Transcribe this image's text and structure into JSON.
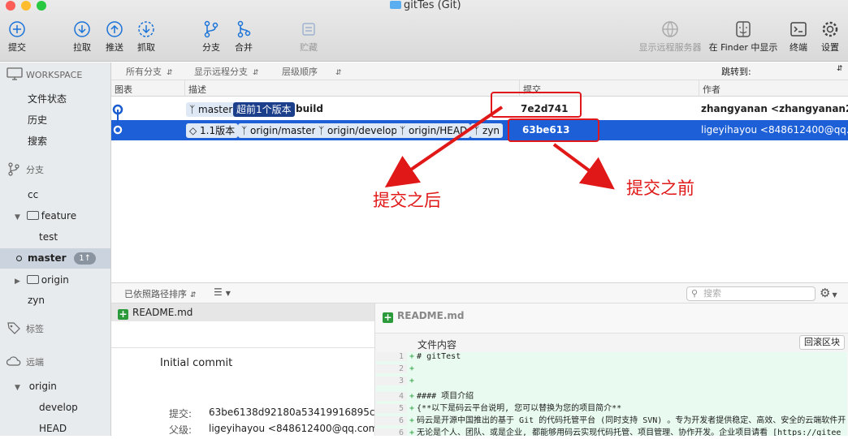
{
  "window": {
    "title": "gitTes (Git)"
  },
  "toolbar": {
    "commit": "提交",
    "pull": "拉取",
    "push": "推送",
    "fetch": "抓取",
    "branch": "分支",
    "merge": "合并",
    "stash": "贮藏",
    "remote_server": "显示远程服务器",
    "finder": "在 Finder 中显示",
    "terminal": "终端",
    "settings": "设置"
  },
  "sidebar": {
    "workspace": "WORKSPACE",
    "workspace_items": [
      "文件状态",
      "历史",
      "搜索"
    ],
    "branches_header": "分支",
    "branches": [
      "cc",
      "feature",
      "test",
      "master",
      "origin",
      "zyn"
    ],
    "master_badge": "1↑",
    "tags_header": "标签",
    "remotes_header": "远端",
    "remotes": [
      "origin",
      "develop",
      "HEAD"
    ]
  },
  "filter": {
    "all_branches": "所有分支",
    "show_remote": "显示远程分支",
    "order": "层级顺序",
    "jump": "跳转到:"
  },
  "columns": {
    "graph": "图表",
    "description": "描述",
    "commit": "提交",
    "author": "作者"
  },
  "commits": [
    {
      "tags": [
        "master",
        "超前1个版本"
      ],
      "message": "build",
      "hash": "7e2d741",
      "author": "zhangyanan <zhangyanan28@"
    },
    {
      "tags": [
        "1.1版本",
        "origin/master",
        "origin/develop",
        "origin/HEAD",
        "zyn"
      ],
      "message": "",
      "hash": "63be613",
      "author": "ligeyihayou <848612400@qq.co"
    }
  ],
  "annotations": {
    "after": "提交之后",
    "before": "提交之前"
  },
  "bottom": {
    "sort": "已依照路径排序",
    "search_placeholder": "搜索"
  },
  "file": {
    "name": "README.md",
    "content_label": "文件内容",
    "rollback": "回滚区块"
  },
  "commit_detail": {
    "message": "Initial commit",
    "commit_label": "提交:",
    "commit_value": "63be6138d92180a53419916895cd9",
    "parent_label": "父级:",
    "parent_value": "ligeyihayou <848612400@qq.com>"
  },
  "diff_lines": [
    {
      "n": "1",
      "text": "# gitTest"
    },
    {
      "n": "2",
      "text": ""
    },
    {
      "n": "3",
      "text": ""
    },
    {
      "n": "4",
      "text": "#### 项目介绍"
    },
    {
      "n": "5",
      "text": "{**以下是码云平台说明, 您可以替换为您的项目简介**"
    },
    {
      "n": "6",
      "text": "码云是开源中国推出的基于 Git 的代码托管平台 (同时支持 SVN) 。专为开发者提供稳定、高效、安全的云端软件开"
    },
    {
      "n": "6",
      "text": "无论是个人、团队、或是企业, 都能够用码云实现代码托管、项目管理、协作开发。企业项目请看 [https://gitee"
    },
    {
      "n": "7",
      "text": ""
    }
  ]
}
